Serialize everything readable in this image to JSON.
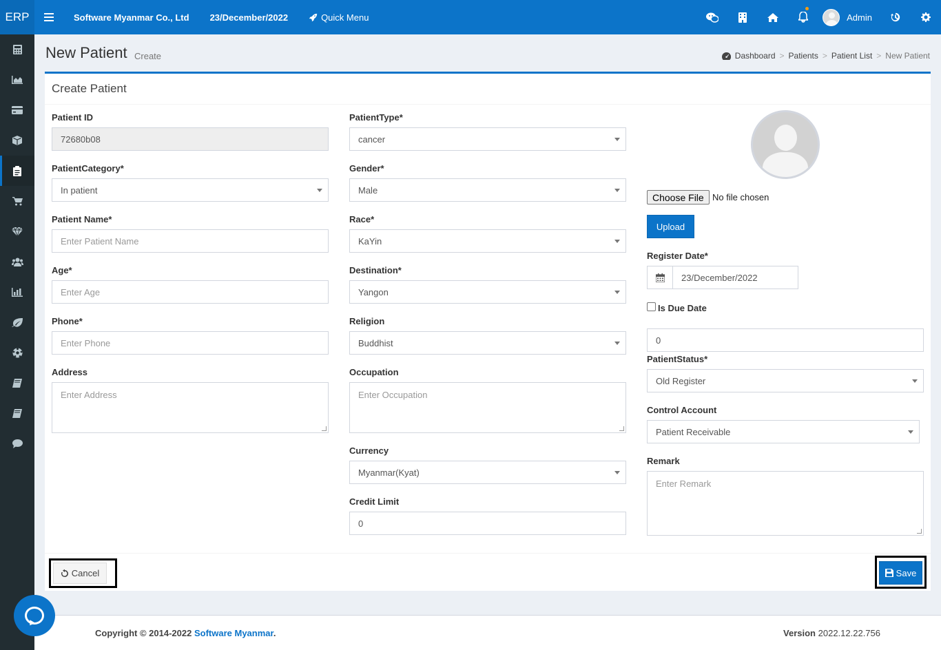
{
  "topbar": {
    "brand": "ERP",
    "company": "Software Myanmar Co., Ltd",
    "date": "23/December/2022",
    "quick_menu": "Quick Menu",
    "user_name": "Admin"
  },
  "page": {
    "title": "New Patient",
    "subtitle": "Create",
    "breadcrumb": [
      "Dashboard",
      "Patients",
      "Patient List",
      "New Patient"
    ]
  },
  "form": {
    "title": "Create Patient",
    "patient_id": {
      "label": "Patient ID",
      "value": "72680b08"
    },
    "patient_category": {
      "label": "PatientCategory*",
      "value": "In patient"
    },
    "patient_name": {
      "label": "Patient Name*",
      "placeholder": "Enter Patient Name"
    },
    "age": {
      "label": "Age*",
      "placeholder": "Enter Age"
    },
    "phone": {
      "label": "Phone*",
      "placeholder": "Enter Phone"
    },
    "address": {
      "label": "Address",
      "placeholder": "Enter Address"
    },
    "patient_type": {
      "label": "PatientType*",
      "value": "cancer"
    },
    "gender": {
      "label": "Gender*",
      "value": "Male"
    },
    "race": {
      "label": "Race*",
      "value": "KaYin"
    },
    "destination": {
      "label": "Destination*",
      "value": "Yangon"
    },
    "religion": {
      "label": "Religion",
      "value": "Buddhist"
    },
    "occupation": {
      "label": "Occupation",
      "placeholder": "Enter Occupation"
    },
    "currency": {
      "label": "Currency",
      "value": "Myanmar(Kyat)"
    },
    "credit_limit": {
      "label": "Credit Limit",
      "value": "0"
    },
    "file": {
      "button": "Choose File",
      "status": "No file chosen"
    },
    "upload_label": "Upload",
    "register_date": {
      "label": "Register Date*",
      "value": "23/December/2022"
    },
    "is_due_date": {
      "label": "Is Due Date",
      "value": "0"
    },
    "patient_status": {
      "label": "PatientStatus*",
      "value": "Old Register"
    },
    "control_account": {
      "label": "Control Account",
      "value": "Patient Receivable"
    },
    "remark": {
      "label": "Remark",
      "placeholder": "Enter Remark"
    },
    "cancel_label": "Cancel",
    "save_label": "Save"
  },
  "footer": {
    "copyright": "Copyright © 2014-2022",
    "company_link": "Software Myanmar",
    "period": ".",
    "version_label": "Version",
    "version": "2022.12.22.756"
  },
  "colors": {
    "primary": "#0c74c9",
    "sidebar": "#222d32",
    "content_bg": "#ecf0f5"
  },
  "icons": {
    "sidebar": [
      "calculator-icon",
      "area-chart-icon",
      "credit-card-icon",
      "cube-icon",
      "clipboard-icon",
      "cart-icon",
      "diamond-icon",
      "users-icon",
      "bar-chart-icon",
      "leaf-icon",
      "soccer-ball-icon",
      "book-icon",
      "book-icon",
      "comment-icon"
    ]
  }
}
